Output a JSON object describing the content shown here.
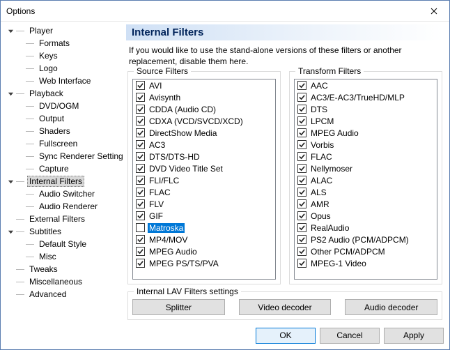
{
  "window": {
    "title": "Options"
  },
  "nav": {
    "tree": [
      {
        "label": "Player",
        "expanded": true,
        "children": [
          {
            "label": "Formats"
          },
          {
            "label": "Keys"
          },
          {
            "label": "Logo"
          },
          {
            "label": "Web Interface"
          }
        ]
      },
      {
        "label": "Playback",
        "expanded": true,
        "children": [
          {
            "label": "DVD/OGM"
          },
          {
            "label": "Output"
          },
          {
            "label": "Shaders"
          },
          {
            "label": "Fullscreen"
          },
          {
            "label": "Sync Renderer Settings"
          },
          {
            "label": "Capture"
          }
        ]
      },
      {
        "label": "Internal Filters",
        "expanded": true,
        "selected": true,
        "children": [
          {
            "label": "Audio Switcher"
          },
          {
            "label": "Audio Renderer"
          }
        ]
      },
      {
        "label": "External Filters"
      },
      {
        "label": "Subtitles",
        "expanded": true,
        "children": [
          {
            "label": "Default Style"
          },
          {
            "label": "Misc"
          }
        ]
      },
      {
        "label": "Tweaks"
      },
      {
        "label": "Miscellaneous"
      },
      {
        "label": "Advanced"
      }
    ]
  },
  "panel": {
    "title": "Internal Filters",
    "description": "If you would like to use the stand-alone versions of these filters or another replacement, disable them here.",
    "source": {
      "legend": "Source Filters",
      "items": [
        {
          "label": "AVI",
          "checked": true
        },
        {
          "label": "Avisynth",
          "checked": true
        },
        {
          "label": "CDDA (Audio CD)",
          "checked": true
        },
        {
          "label": "CDXA (VCD/SVCD/XCD)",
          "checked": true
        },
        {
          "label": "DirectShow Media",
          "checked": true
        },
        {
          "label": "AC3",
          "checked": true
        },
        {
          "label": "DTS/DTS-HD",
          "checked": true
        },
        {
          "label": "DVD Video Title Set",
          "checked": true
        },
        {
          "label": "FLI/FLC",
          "checked": true
        },
        {
          "label": "FLAC",
          "checked": true
        },
        {
          "label": "FLV",
          "checked": true
        },
        {
          "label": "GIF",
          "checked": true
        },
        {
          "label": "Matroska",
          "checked": false,
          "selected": true
        },
        {
          "label": "MP4/MOV",
          "checked": true
        },
        {
          "label": "MPEG Audio",
          "checked": true
        },
        {
          "label": "MPEG PS/TS/PVA",
          "checked": true
        }
      ]
    },
    "transform": {
      "legend": "Transform Filters",
      "items": [
        {
          "label": "AAC",
          "checked": true
        },
        {
          "label": "AC3/E-AC3/TrueHD/MLP",
          "checked": true
        },
        {
          "label": "DTS",
          "checked": true
        },
        {
          "label": "LPCM",
          "checked": true
        },
        {
          "label": "MPEG Audio",
          "checked": true
        },
        {
          "label": "Vorbis",
          "checked": true
        },
        {
          "label": "FLAC",
          "checked": true
        },
        {
          "label": "Nellymoser",
          "checked": true
        },
        {
          "label": "ALAC",
          "checked": true
        },
        {
          "label": "ALS",
          "checked": true
        },
        {
          "label": "AMR",
          "checked": true
        },
        {
          "label": "Opus",
          "checked": true
        },
        {
          "label": "RealAudio",
          "checked": true
        },
        {
          "label": "PS2 Audio (PCM/ADPCM)",
          "checked": true
        },
        {
          "label": "Other PCM/ADPCM",
          "checked": true
        },
        {
          "label": "MPEG-1 Video",
          "checked": true
        }
      ]
    },
    "lav": {
      "legend": "Internal LAV Filters settings",
      "splitter": "Splitter",
      "video": "Video decoder",
      "audio": "Audio decoder"
    }
  },
  "buttons": {
    "ok": "OK",
    "cancel": "Cancel",
    "apply": "Apply"
  }
}
